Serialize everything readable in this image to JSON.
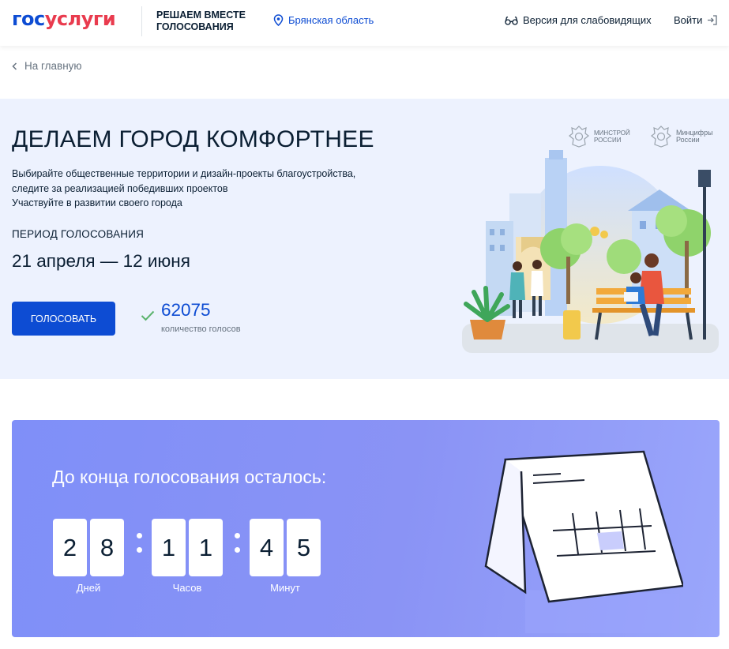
{
  "header": {
    "logo_part1": "гос",
    "logo_part2": "услуги",
    "project_title": "РЕШАЕМ ВМЕСТЕ ГОЛОСОВАНИЯ",
    "region": "Брянская область",
    "impaired_version": "Версия для слабовидящих",
    "login": "Войти"
  },
  "breadcrumb": {
    "back_label": "На главную"
  },
  "hero": {
    "title": "ДЕЛАЕМ ГОРОД КОМФОРТНЕЕ",
    "description_line1": "Выбирайте общественные территории и дизайн-проекты благоустройства,",
    "description_line2": "следите за реализацией победивших проектов",
    "description_line3": "Участвуйте в развитии своего города",
    "period_label": "ПЕРИОД ГОЛОСОВАНИЯ",
    "period_value": "21 апреля — 12 июня",
    "vote_button": "ГОЛОСОВАТЬ",
    "votes_count": "62075",
    "votes_label": "количество голосов",
    "ministries": [
      {
        "line1": "МИНСТРОЙ",
        "line2": "РОССИИ"
      },
      {
        "line1": "Минцифры",
        "line2": "России"
      }
    ]
  },
  "countdown": {
    "title": "До конца голосования осталось:",
    "days": [
      "2",
      "8"
    ],
    "hours": [
      "1",
      "1"
    ],
    "minutes": [
      "4",
      "5"
    ],
    "days_label": "Дней",
    "hours_label": "Часов",
    "minutes_label": "Минут"
  },
  "colors": {
    "primary": "#0d4cd3",
    "logo_red": "#e93b4e",
    "hero_bg": "#edf2fe",
    "countdown_bg": "#8a93f5",
    "check_green": "#5bb36d"
  },
  "icons": {
    "region": "location-pin-icon",
    "impaired": "glasses-icon",
    "login": "login-arrow-icon",
    "back": "chevron-left-icon",
    "votes": "checkmark-icon"
  }
}
